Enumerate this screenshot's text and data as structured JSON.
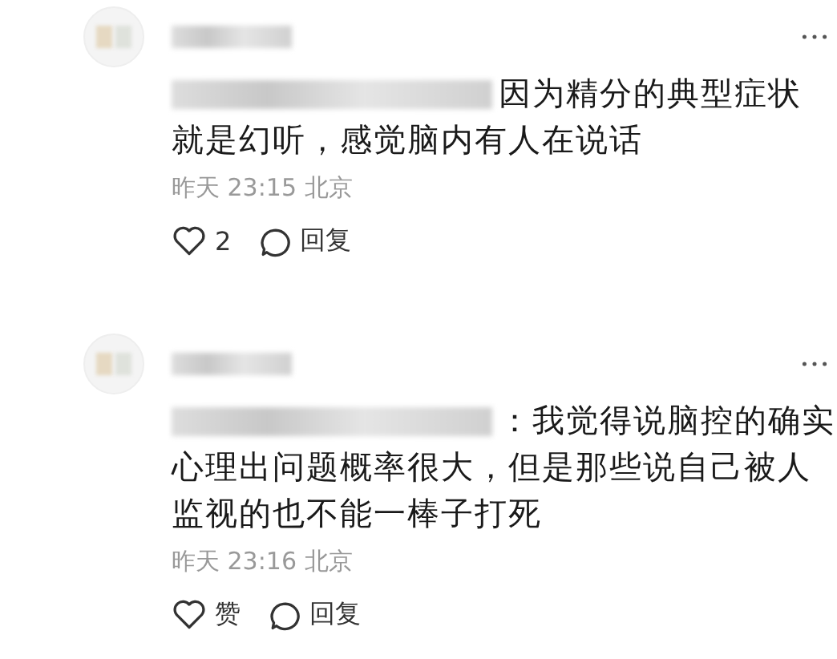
{
  "comments": [
    {
      "lines": [
        "因为精分的典型症状",
        "就是幻听，感觉脑内有人在说话"
      ],
      "time": "昨天 23:15 北京",
      "like": "2",
      "reply": "回复"
    },
    {
      "lines": [
        "：我觉得说脑控的确实",
        "心理出问题概率很大，但是那些说自己被人",
        "监视的也不能一棒子打死"
      ],
      "time": "昨天 23:16 北京",
      "like": "赞",
      "reply": "回复"
    }
  ]
}
